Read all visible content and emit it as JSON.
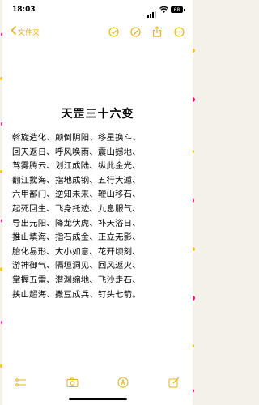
{
  "status": {
    "time": "18:03",
    "battery": "68"
  },
  "nav": {
    "back_label": "文件夹"
  },
  "note": {
    "title": "天罡三十六变",
    "lines": [
      "斡旋造化、颠倒阴阳、移星换斗、",
      "回天返日、呼风唤雨、震山撼地、",
      "驾雾腾云、划江成陆、纵此金光、",
      "翻江搅海、指地成钢、五行大遁、",
      "六甲部门、逆知未来、鞭山移石、",
      "起死回生、飞身托迹、九息服气、",
      "导出元阳、降龙伏虎、补天浴日、",
      "推山填海、指石成金、正立无影、",
      "胎化易形、大小如意、花开顷刻、",
      "游神御气、隔垣洞见、回风返火、",
      "掌握五雷、潜渊缩地、飞沙走石、",
      "挟山超海、撒豆成兵、钉头七箭。"
    ]
  },
  "colors": {
    "accent": "#e1b21a",
    "border_pink": "#e2147a",
    "border_yellow": "#f6c21a"
  }
}
